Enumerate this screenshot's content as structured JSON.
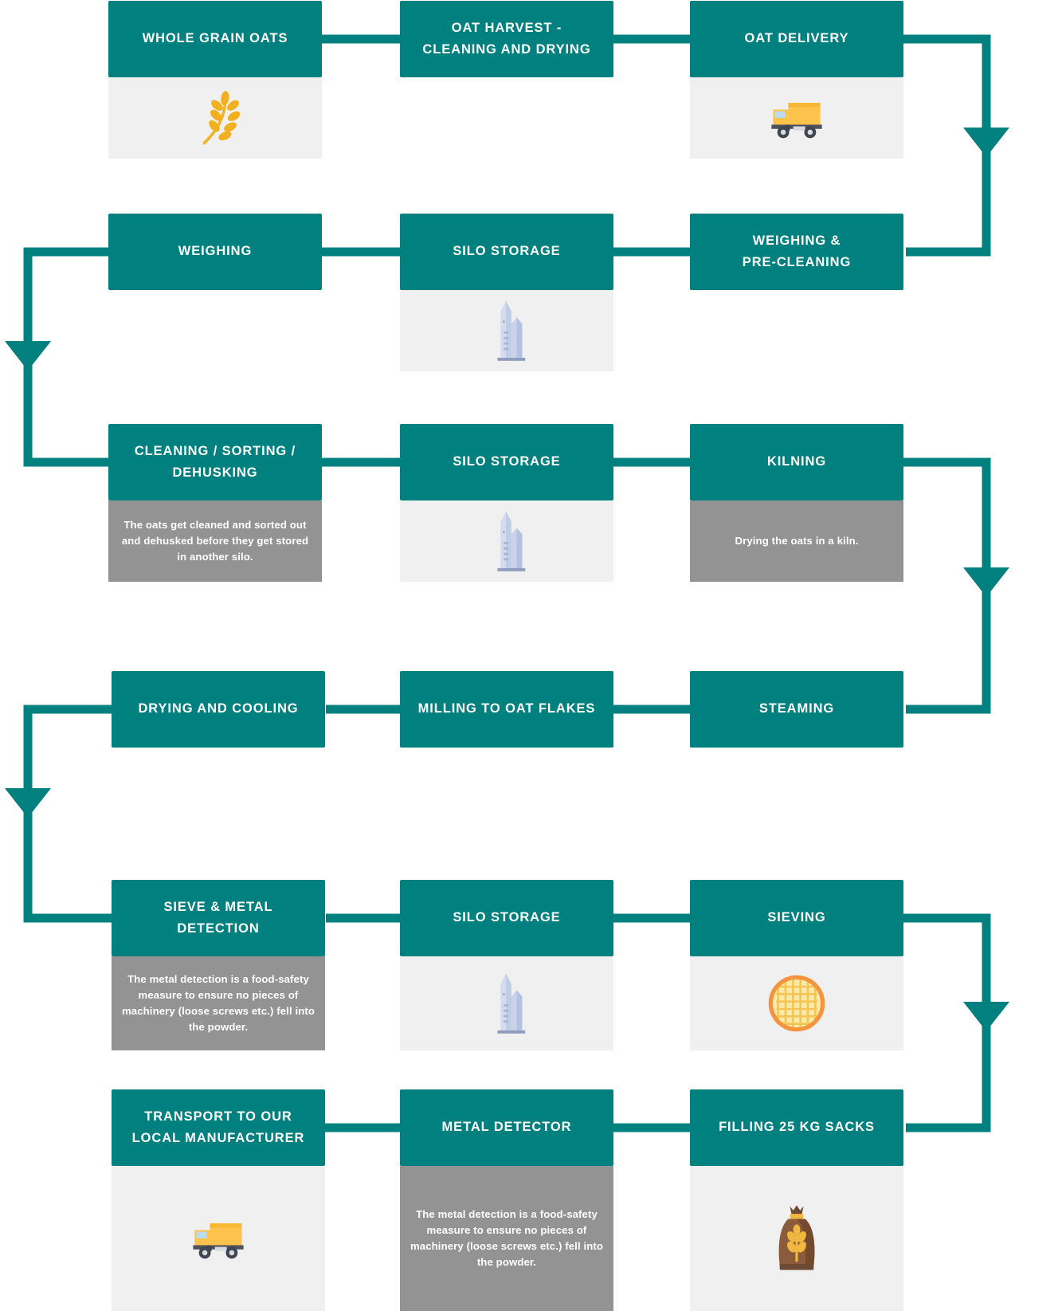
{
  "diagram": {
    "title": "Oat processing flow chart",
    "colors": {
      "accent_teal": "#00807F",
      "description_gray": "#939393",
      "icon_panel_gray": "#F0F0F0",
      "label_text": "#FFFFFF",
      "background": "#FFFFFF"
    }
  },
  "rows": [
    {
      "row": 1,
      "nodes": [
        {
          "id": "whole-grain-oats",
          "label": "WHOLE GRAIN OATS",
          "body_type": "icon",
          "icon": "wheat-stalk-icon",
          "description": ""
        },
        {
          "id": "oat-harvest-cleaning-and-drying",
          "label": "OAT HARVEST - CLEANING AND DRYING",
          "label_line1": "OAT HARVEST -",
          "label_line2": "CLEANING AND DRYING",
          "body_type": "none",
          "icon": "",
          "description": ""
        },
        {
          "id": "oat-delivery",
          "label": "OAT DELIVERY",
          "body_type": "icon",
          "icon": "delivery-truck-icon",
          "description": ""
        }
      ]
    },
    {
      "row": 2,
      "nodes": [
        {
          "id": "weighing",
          "label": "WEIGHING",
          "body_type": "none",
          "icon": "",
          "description": ""
        },
        {
          "id": "silo-storage-1",
          "label": "SILO STORAGE",
          "body_type": "icon",
          "icon": "silo-icon",
          "description": ""
        },
        {
          "id": "weighing-and-pre-cleaning",
          "label": "WEIGHING & PRE-CLEANING",
          "label_line1": "WEIGHING &",
          "label_line2": "PRE-CLEANING",
          "body_type": "none",
          "icon": "",
          "description": ""
        }
      ]
    },
    {
      "row": 3,
      "nodes": [
        {
          "id": "cleaning-sorting-dehusking",
          "label": "CLEANING / SORTING / DEHUSKING",
          "label_line1": "CLEANING / SORTING /",
          "label_line2": "DEHUSKING",
          "body_type": "desc",
          "icon": "",
          "description": "The oats get cleaned and sorted out and dehusked before they get stored in another silo."
        },
        {
          "id": "silo-storage-2",
          "label": "SILO STORAGE",
          "body_type": "icon",
          "icon": "silo-icon",
          "description": ""
        },
        {
          "id": "kilning",
          "label": "KILNING",
          "body_type": "desc",
          "icon": "",
          "description": "Drying the oats in a kiln."
        }
      ]
    },
    {
      "row": 4,
      "nodes": [
        {
          "id": "drying-and-cooling",
          "label": "DRYING AND COOLING",
          "body_type": "none",
          "icon": "",
          "description": ""
        },
        {
          "id": "milling-to-oat-flakes",
          "label": "MILLING TO OAT FLAKES",
          "body_type": "none",
          "icon": "",
          "description": ""
        },
        {
          "id": "steaming",
          "label": "STEAMING",
          "body_type": "none",
          "icon": "",
          "description": ""
        }
      ]
    },
    {
      "row": 5,
      "nodes": [
        {
          "id": "sieve-and-metal-detection",
          "label": "SIEVE & METAL DETECTION",
          "label_line1": "SIEVE & METAL",
          "label_line2": "DETECTION",
          "body_type": "desc",
          "icon": "",
          "description": "The metal detection is a food-safety measure to ensure no pieces of machinery (loose screws etc.) fell into the powder."
        },
        {
          "id": "silo-storage-3",
          "label": "SILO STORAGE",
          "body_type": "icon",
          "icon": "silo-icon",
          "description": ""
        },
        {
          "id": "sieving",
          "label": "SIEVING",
          "body_type": "icon",
          "icon": "sieve-icon",
          "description": ""
        }
      ]
    },
    {
      "row": 6,
      "nodes": [
        {
          "id": "transport-to-our-local-manufacturer",
          "label": "TRANSPORT TO OUR LOCAL MANUFACTURER",
          "label_line1": "TRANSPORT TO OUR",
          "label_line2": "LOCAL MANUFACTURER",
          "body_type": "icon",
          "icon": "delivery-truck-icon",
          "description": ""
        },
        {
          "id": "metal-detector",
          "label": "METAL DETECTOR",
          "body_type": "desc",
          "icon": "",
          "description": "The metal detection is a food-safety measure to ensure no pieces of machinery (loose screws etc.) fell into the powder."
        },
        {
          "id": "filling-25-kg-sacks",
          "label": "FILLING 25 KG SACKS",
          "body_type": "icon",
          "icon": "grain-sack-icon",
          "description": ""
        }
      ]
    }
  ]
}
